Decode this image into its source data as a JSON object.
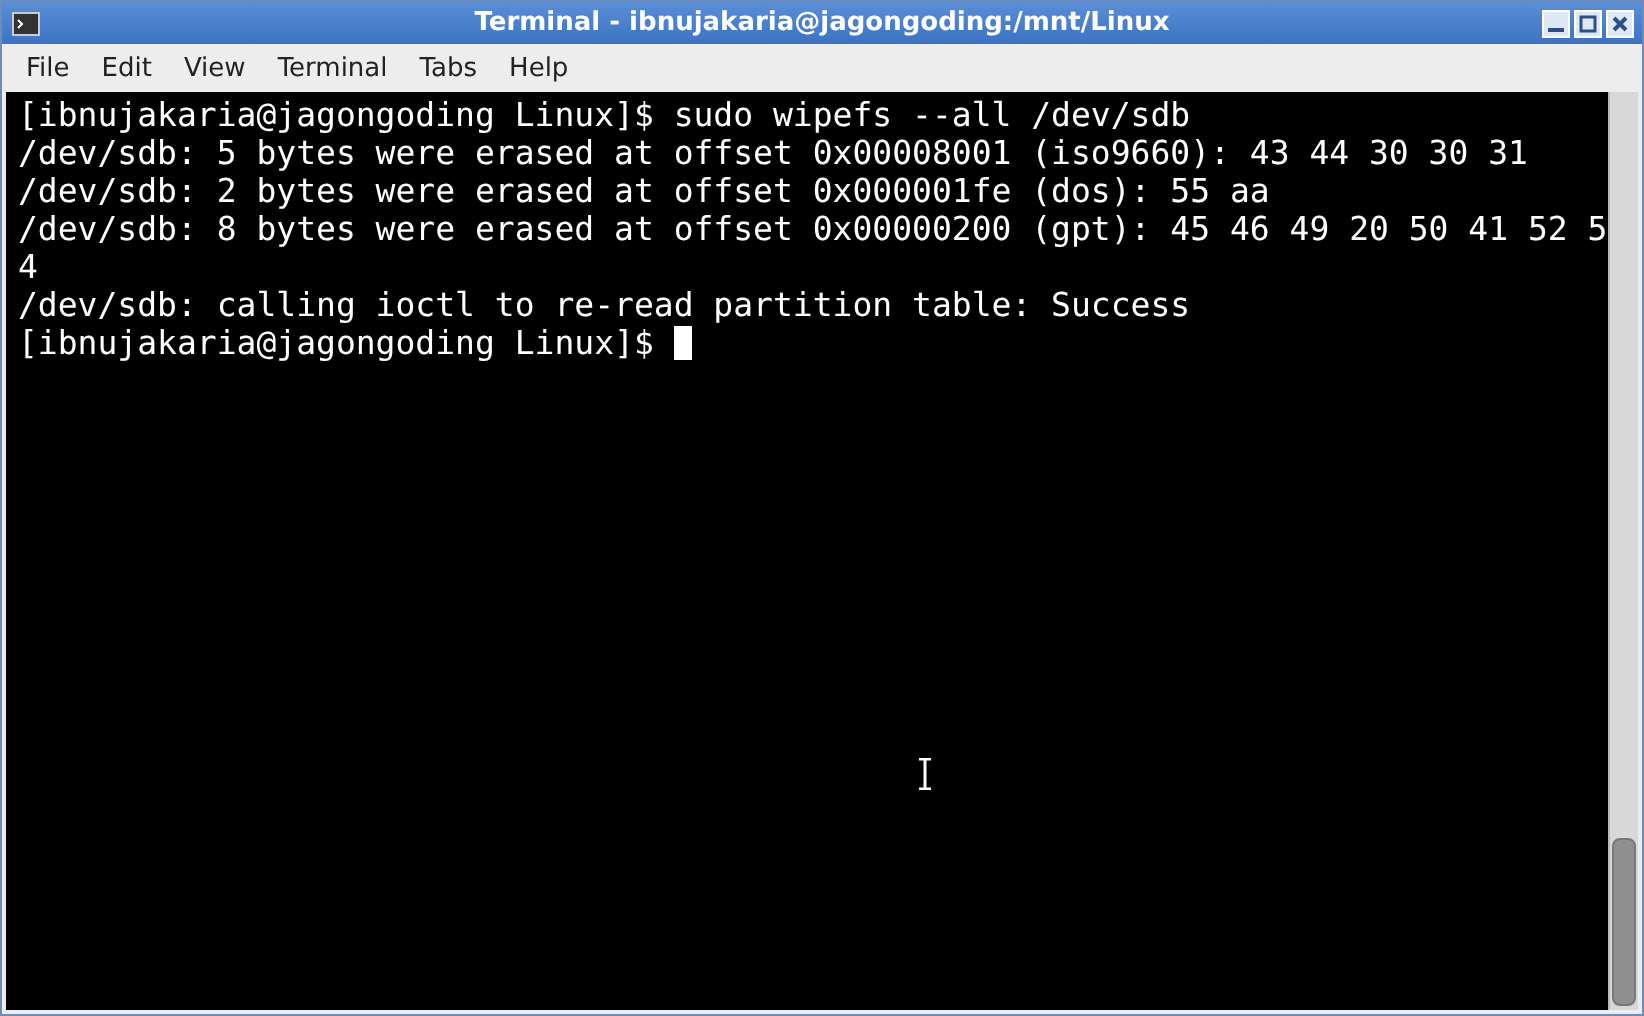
{
  "window": {
    "title": "Terminal - ibnujakaria@jagongoding:/mnt/Linux"
  },
  "menu": [
    "File",
    "Edit",
    "View",
    "Terminal",
    "Tabs",
    "Help"
  ],
  "terminal": {
    "lines": [
      "[ibnujakaria@jagongoding Linux]$ sudo wipefs --all /dev/sdb",
      "/dev/sdb: 5 bytes were erased at offset 0x00008001 (iso9660): 43 44 30 30 31",
      "/dev/sdb: 2 bytes were erased at offset 0x000001fe (dos): 55 aa",
      "/dev/sdb: 8 bytes were erased at offset 0x00000200 (gpt): 45 46 49 20 50 41 52 5",
      "4",
      "/dev/sdb: calling ioctl to re-read partition table: Success"
    ],
    "prompt": "[ibnujakaria@jagongoding Linux]$ "
  }
}
